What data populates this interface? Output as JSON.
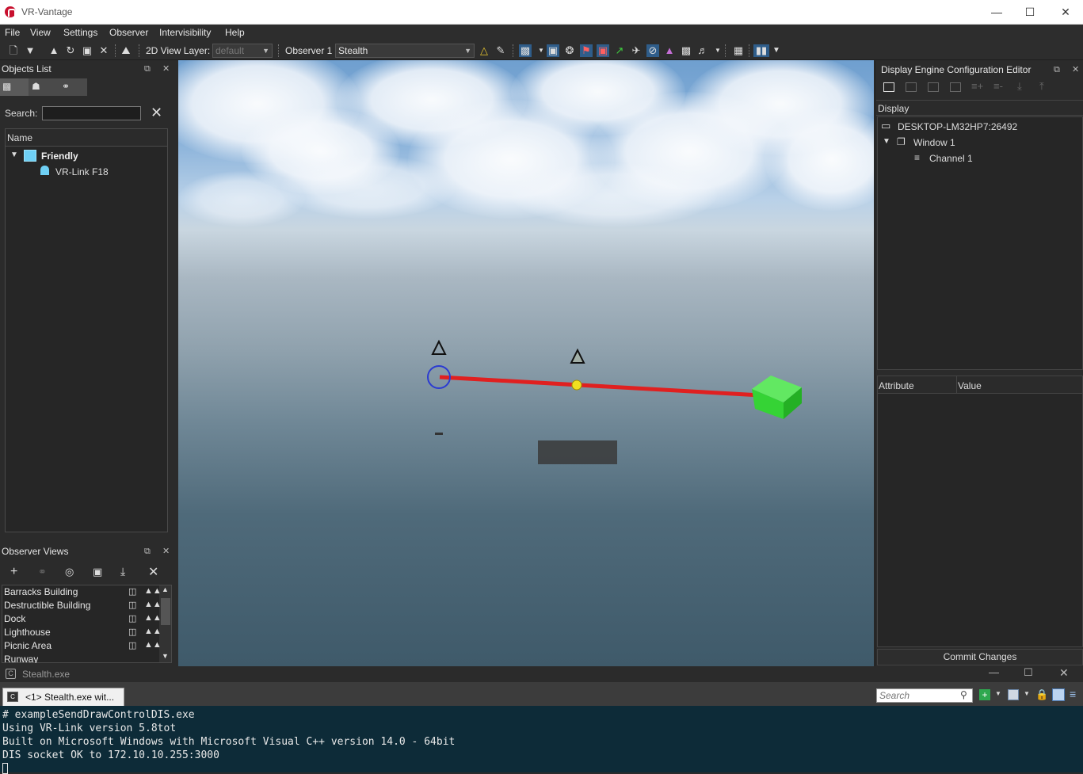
{
  "app": {
    "title": "VR-Vantage"
  },
  "menu": [
    "File",
    "View",
    "Settings",
    "Observer",
    "Intervisibility",
    "Help"
  ],
  "toolbar": {
    "view_layer_label": "2D View Layer:",
    "view_layer_value": "default",
    "observer_label": "Observer 1",
    "observer_value": "Stealth"
  },
  "objects_list": {
    "title": "Objects List",
    "search_label": "Search:",
    "search_value": "",
    "column_name": "Name",
    "groups": [
      {
        "label": "Friendly",
        "color": "#6fd0f5",
        "items": [
          "VR-Link F18"
        ]
      }
    ]
  },
  "observer_views": {
    "title": "Observer Views",
    "items": [
      "Barracks Building",
      "Destructible Building",
      "Dock",
      "Lighthouse",
      "Picnic Area",
      "Runway"
    ]
  },
  "display_editor": {
    "title": "Display Engine Configuration Editor",
    "section": "Display",
    "tree": [
      {
        "label": "DESKTOP-LM32HP7:26492",
        "icon": "monitor-icon"
      },
      {
        "label": "Window 1",
        "icon": "window-icon"
      },
      {
        "label": "Channel 1",
        "icon": "list-icon"
      }
    ],
    "attr_col": "Attribute",
    "value_col": "Value",
    "commit_label": "Commit Changes"
  },
  "console": {
    "window_title": "Stealth.exe",
    "tab_label": "<1> Stealth.exe wit...",
    "search_placeholder": "Search",
    "lines": [
      "# exampleSendDrawControlDIS.exe",
      "Using VR-Link version 5.8tot",
      "Built on Microsoft Windows with Microsoft Visual C++ version 14.0 - 64bit",
      "DIS socket OK to 172.10.10.255:3000"
    ]
  },
  "colors": {
    "accent": "#2f5d8a",
    "line": "#e02020",
    "cube": "#35d335",
    "console_bg": "#0d2b38"
  }
}
